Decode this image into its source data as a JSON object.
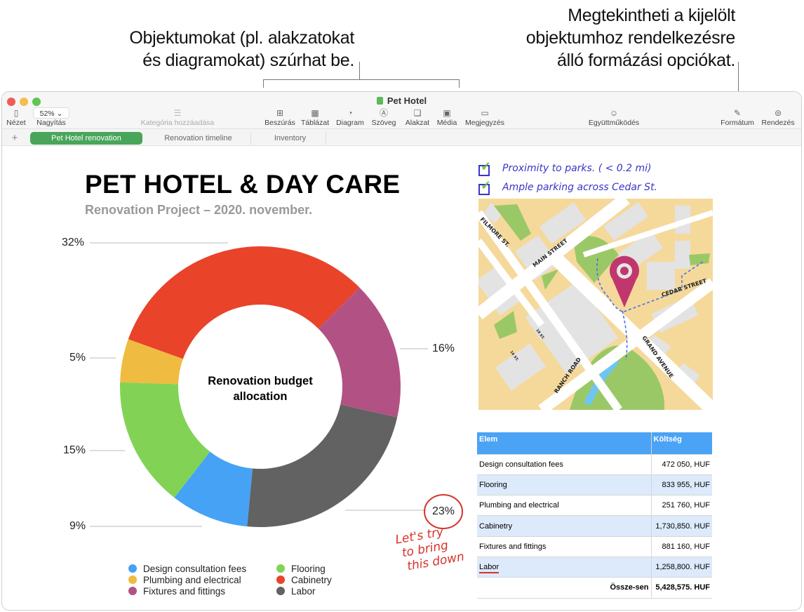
{
  "callouts": {
    "insert": [
      "Objektumokat (pl. alakzatokat",
      "és diagramokat) szúrhat be."
    ],
    "format": [
      "Megtekintheti a kijelölt",
      "objektumhoz rendelkezésre",
      "álló formázási opciókat."
    ]
  },
  "window": {
    "title": "Pet Hotel",
    "traffic_lights": {
      "close": "#ee5d56",
      "minimize": "#f5bd4f",
      "zoom": "#60c454"
    }
  },
  "toolbar": {
    "view": "Nézet",
    "zoom_value": "52%",
    "zoom_label": "Nagyítás",
    "category": "Kategória hozzáadása",
    "insert": "Beszúrás",
    "table": "Táblázat",
    "chart": "Diagram",
    "text": "Szöveg",
    "shape": "Alakzat",
    "media": "Média",
    "comment": "Megjegyzés",
    "collaborate": "Együttműködés",
    "format": "Formátum",
    "organize": "Rendezés"
  },
  "tabs": {
    "add": "+",
    "items": [
      "Pet Hotel renovation",
      "Renovation timeline",
      "Inventory"
    ],
    "active_index": 0,
    "active_color": "#49a55a"
  },
  "document": {
    "title": "PET HOTEL & DAY CARE",
    "subtitle": "Renovation Project – 2020. november.",
    "checklist": [
      "Proximity to parks. ( < 0.2 mi)",
      "Ample parking across  Cedar St."
    ],
    "annotation": [
      "Let's try",
      "to bring",
      "this down"
    ],
    "map_labels": [
      "FILMORE ST.",
      "MAIN STREET",
      "CEDAR STREET",
      "GRAND AVENUE",
      "RANCH ROAD",
      "18 ST.",
      "16 ST."
    ]
  },
  "chart_data": {
    "type": "pie",
    "variant": "donut",
    "title": "Renovation budget allocation",
    "legend_position": "bottom",
    "slices": [
      {
        "name": "Fixtures and fittings",
        "value": 16,
        "label": "16%",
        "color": "#b25284"
      },
      {
        "name": "Labor",
        "value": 23,
        "label": "23%",
        "color": "#626262"
      },
      {
        "name": "Design consultation fees",
        "value": 9,
        "label": "9%",
        "color": "#45a2f5"
      },
      {
        "name": "Flooring",
        "value": 15,
        "label": "15%",
        "color": "#82d355"
      },
      {
        "name": "Plumbing and electrical",
        "value": 5,
        "label": "5%",
        "color": "#f0bb41"
      },
      {
        "name": "Cabinetry",
        "value": 32,
        "label": "32%",
        "color": "#e9432a"
      }
    ],
    "legend": [
      {
        "name": "Design consultation fees",
        "color": "#45a2f5"
      },
      {
        "name": "Plumbing and electrical",
        "color": "#f0bb41"
      },
      {
        "name": "Fixtures and fittings",
        "color": "#b25284"
      },
      {
        "name": "Flooring",
        "color": "#82d355"
      },
      {
        "name": "Cabinetry",
        "color": "#e9432a"
      },
      {
        "name": "Labor",
        "color": "#626262"
      }
    ]
  },
  "budget_table": {
    "headers": [
      "Elem",
      "Költség"
    ],
    "rows": [
      [
        "Design consultation fees",
        "472 050, HUF"
      ],
      [
        "Flooring",
        "833 955, HUF"
      ],
      [
        "Plumbing and electrical",
        "251 760, HUF"
      ],
      [
        "Cabinetry",
        "1,730,850. HUF"
      ],
      [
        "Fixtures and fittings",
        "881 160, HUF"
      ],
      [
        "Labor",
        "1,258,800. HUF"
      ]
    ],
    "total_label": "Össze-sen",
    "total_value": "5,428,575. HUF",
    "header_color": "#4aa3f5",
    "alt_row_color": "#dceafb"
  }
}
